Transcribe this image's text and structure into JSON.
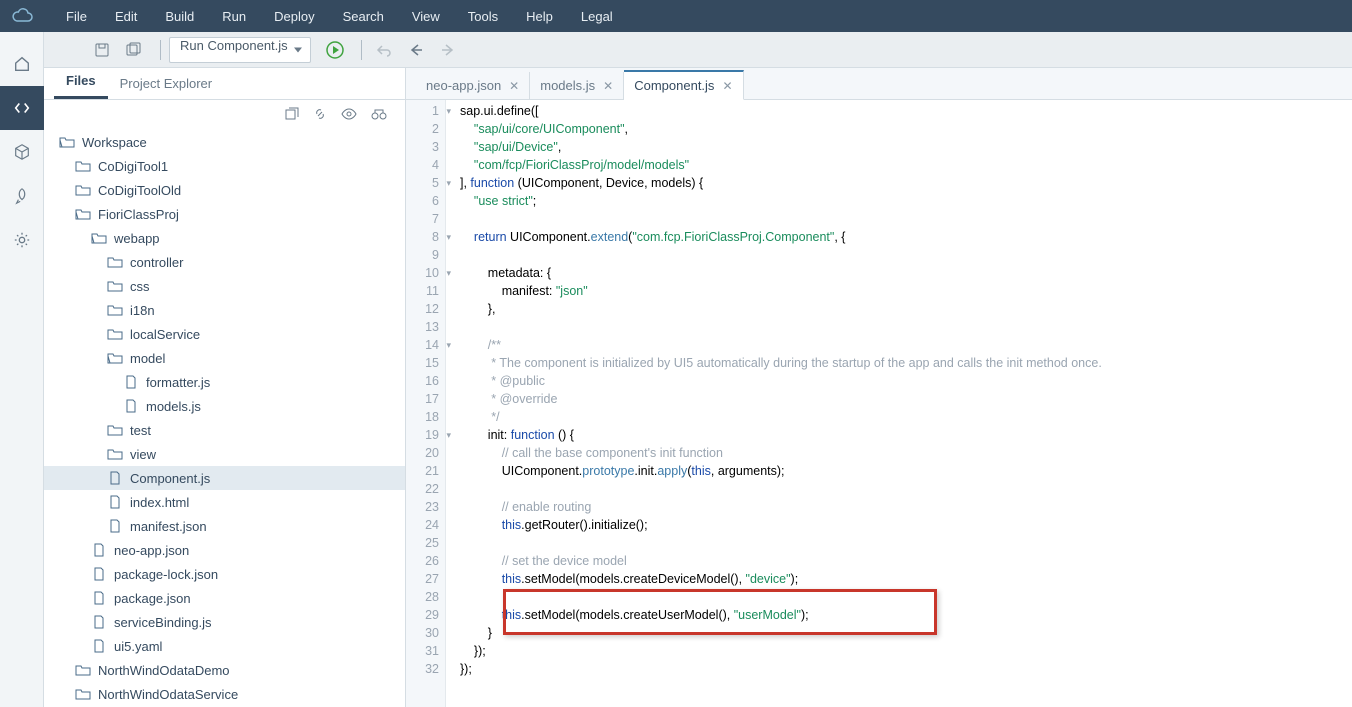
{
  "menu": [
    "File",
    "Edit",
    "Build",
    "Run",
    "Deploy",
    "Search",
    "View",
    "Tools",
    "Help",
    "Legal"
  ],
  "toolbar": {
    "run_select": "Run Component.js"
  },
  "side_tabs": {
    "files": "Files",
    "project_explorer": "Project Explorer"
  },
  "tree": {
    "workspace": "Workspace",
    "items": [
      "CoDigiTool1",
      "CoDigiToolOld",
      "FioriClassProj",
      "webapp",
      "controller",
      "css",
      "i18n",
      "localService",
      "model",
      "formatter.js",
      "models.js",
      "test",
      "view",
      "Component.js",
      "index.html",
      "manifest.json",
      "neo-app.json",
      "package-lock.json",
      "package.json",
      "serviceBinding.js",
      "ui5.yaml",
      "NorthWindOdataDemo",
      "NorthWindOdataService"
    ]
  },
  "editor_tabs": [
    "neo-app.json",
    "models.js",
    "Component.js"
  ],
  "code": {
    "l1": "sap.ui.define([",
    "l2_str": "\"sap/ui/core/UIComponent\"",
    "l3_str": "\"sap/ui/Device\"",
    "l4_str": "\"com/fcp/FioriClassProj/model/models\"",
    "l5a": "], ",
    "l5b": "function",
    "l5c": " (UIComponent, Device, models) {",
    "l6": "\"use strict\"",
    "l6b": ";",
    "l8a": "return",
    "l8b": " UIComponent.",
    "l8c": "extend",
    "l8d": "(",
    "l8e": "\"com.fcp.FioriClassProj.Component\"",
    "l8f": ", {",
    "l10a": "metadata: {",
    "l11a": "manifest: ",
    "l11b": "\"json\"",
    "l12": "},",
    "l14": "/**",
    "l15": " * The component is initialized by UI5 automatically during the startup of the app and calls the init method once.",
    "l16": " * @public",
    "l17": " * @override",
    "l18": " */",
    "l19a": "init: ",
    "l19b": "function",
    "l19c": " () {",
    "l20": "// call the base component's init function",
    "l21a": "UIComponent.",
    "l21b": "prototype",
    "l21c": ".init.",
    "l21d": "apply",
    "l21e": "(",
    "l21f": "this",
    "l21g": ", arguments);",
    "l23": "// enable routing",
    "l24a": "this",
    "l24b": ".getRouter().initialize();",
    "l26": "// set the device model",
    "l27a": "this",
    "l27b": ".setModel(models.createDeviceModel(), ",
    "l27c": "\"device\"",
    "l27d": ");",
    "l29a": "this",
    "l29b": ".setModel(models.createUserModel(), ",
    "l29c": "\"userModel\"",
    "l29d": ");",
    "l30": "}",
    "l31": "});",
    "l32": "});"
  }
}
